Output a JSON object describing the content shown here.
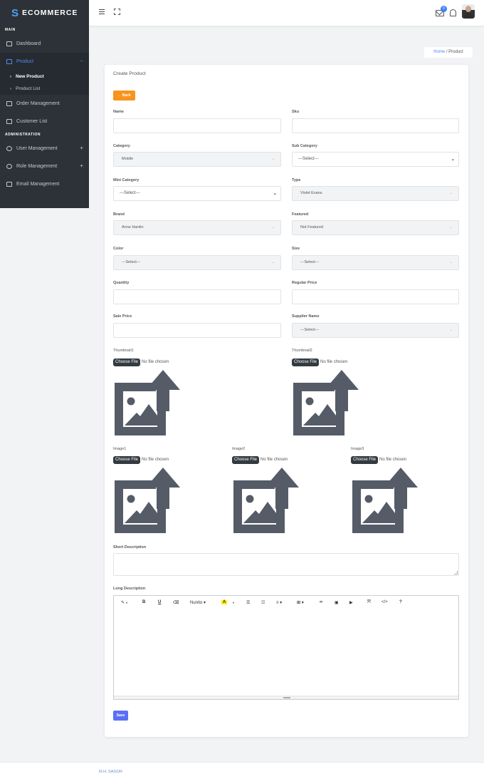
{
  "brand": {
    "letter": "S",
    "name": "ECOMMERCE"
  },
  "header": {
    "mail_count": "0"
  },
  "sidebar": {
    "main_label": "MAIN",
    "admin_label": "ADMINISTRATION",
    "items": {
      "dashboard": "Dashboard",
      "product": "Product",
      "new_product": "New Product",
      "product_list": "Product List",
      "order_management": "Order Management",
      "customer_list": "Customer List",
      "user_management": "User Management",
      "role_management": "Role Management",
      "email_management": "Email Management"
    },
    "collapse_sign": "−",
    "expand_sign": "+"
  },
  "breadcrumb": {
    "home": "Home",
    "sep": "/",
    "current": "Product"
  },
  "form": {
    "title": "Create Product",
    "back_label": "← Back",
    "name_label": "Name",
    "sku_label": "Sku",
    "category_label": "Category",
    "category_value": "Mobile",
    "sub_category_label": "Sub Category",
    "sub_category_value": "---Select---",
    "mini_category_label": "Mini Category",
    "mini_category_value": "---Select---",
    "type_label": "Type",
    "type_value": "Violet Evans",
    "brand_label": "Brand",
    "brand_value": "Anne Hardin",
    "featured_label": "Featured",
    "featured_value": "Not Featured",
    "color_label": "Color",
    "color_value": "---Select---",
    "size_label": "Size",
    "size_value": "---Select---",
    "quantity_label": "Quantity",
    "regular_price_label": "Regular Price",
    "sale_price_label": "Sale Price",
    "supplier_label": "Supplier Name",
    "supplier_value": "---Select---",
    "thumbnail1_label": "Thumbnail1",
    "thumbnail2_label": "Thumbnail2",
    "image1_label": "Image1",
    "image2_label": "Image2",
    "image3_label": "Image3",
    "choose_file": "Choose File",
    "no_file": "No file chosen",
    "short_desc_label": "Short Description",
    "long_desc_label": "Long Description",
    "save_label": "Save"
  },
  "editor": {
    "style_icon": "✎",
    "bold": "B",
    "underline": "U",
    "eraser": "⌫",
    "font": "Nunito ▾",
    "color": "A",
    "caret": "▾",
    "ul": "☰",
    "ol": "☷",
    "align": "≡ ▾",
    "table": "⊞ ▾",
    "link": "∞",
    "picture": "▣",
    "video": "▶",
    "fullscreen": "⤧",
    "code": "</>",
    "help": "?"
  },
  "footer": {
    "text": "M.H. SAGOR"
  },
  "colors": {
    "accent": "#4f8bf6",
    "sidebar": "#2c3238",
    "back": "#f7941d",
    "save": "#5b6ef5"
  }
}
